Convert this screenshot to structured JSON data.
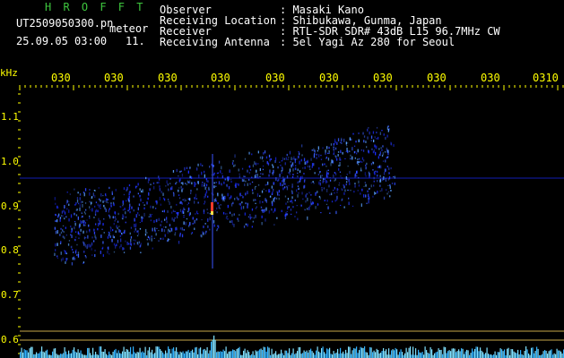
{
  "app": {
    "name": "H R O F F T",
    "file": "UT2509050300.pn",
    "file_tag": "meteor",
    "datetime": "25.09.05 03:00",
    "count": "11."
  },
  "info": {
    "labels": [
      "Observer",
      "Receiving Location",
      "Receiver",
      "Receiving Antenna"
    ],
    "values": [
      ": Masaki Kano",
      ": Shibukawa, Gunma, Japan",
      ": RTL-SDR SDR# 43dB L15 96.7MHz CW",
      ": 5el Yagi Az 280 for Seoul"
    ]
  },
  "axis": {
    "y_unit": "kHz",
    "y_ticks": [
      "1.1",
      "1.0",
      "0.9",
      "0.8",
      "0.7",
      "0.6"
    ],
    "x_ticks": [
      "030",
      "030",
      "030",
      "030",
      "030",
      "030",
      "030",
      "030",
      "030",
      "030",
      "0310"
    ]
  },
  "colors": {
    "title": "#3ec63e",
    "text": "#ffffff",
    "axis": "#ffff00",
    "signal_low": "#1a2cff",
    "signal_mid": "#5aa0ff",
    "signal_peak": "#ff3b2a",
    "baseline": "#7fe0ff"
  }
}
